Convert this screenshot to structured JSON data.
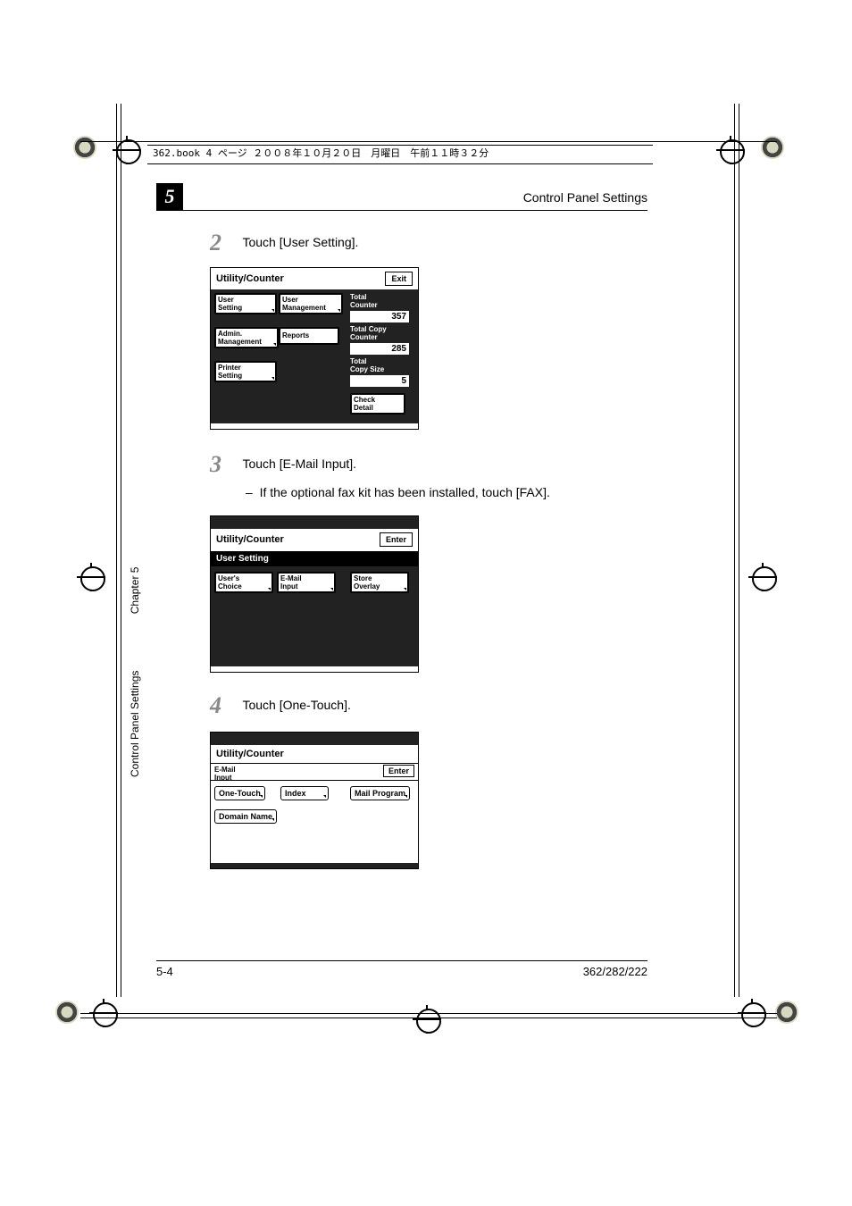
{
  "header_strip": "362.book  4 ページ  ２００８年１０月２０日　月曜日　午前１１時３２分",
  "chapter_number": "5",
  "header_title": "Control Panel Settings",
  "side": {
    "section": "Control Panel Settings",
    "chapter": "Chapter 5"
  },
  "steps": {
    "s2": {
      "num": "2",
      "text": "Touch [User Setting]."
    },
    "s3": {
      "num": "3",
      "text": "Touch [E-Mail Input].",
      "sub": "If the optional fax kit has been installed, touch [FAX]."
    },
    "s4": {
      "num": "4",
      "text": "Touch [One-Touch]."
    }
  },
  "screen1": {
    "title": "Utility/Counter",
    "exit": "Exit",
    "keys": {
      "user_setting": "User\nSetting",
      "user_mgmt": "User\nManagement",
      "admin_mgmt": "Admin.\nManagement",
      "reports": "Reports",
      "printer_setting": "Printer\nSetting"
    },
    "labels": {
      "total_counter": "Total\nCounter",
      "total_copy_counter": "Total Copy\nCounter",
      "total_copy_size": "Total\nCopy Size",
      "check_detail": "Check\nDetail"
    },
    "values": {
      "total_counter": "357",
      "total_copy_counter": "285",
      "total_copy_size": "5"
    }
  },
  "screen2": {
    "title": "Utility/Counter",
    "enter": "Enter",
    "subheader": "User Setting",
    "keys": {
      "users_choice": "User's\nChoice",
      "email_input": "E-Mail\nInput",
      "store_overlay": "Store\nOverlay"
    }
  },
  "screen3": {
    "title": "Utility/Counter",
    "tab": "E-Mail\nInput",
    "enter": "Enter",
    "keys": {
      "one_touch": "One-Touch",
      "index": "Index",
      "mail_program": "Mail Program",
      "domain_name": "Domain Name"
    }
  },
  "footer": {
    "left": "5-4",
    "right": "362/282/222"
  }
}
